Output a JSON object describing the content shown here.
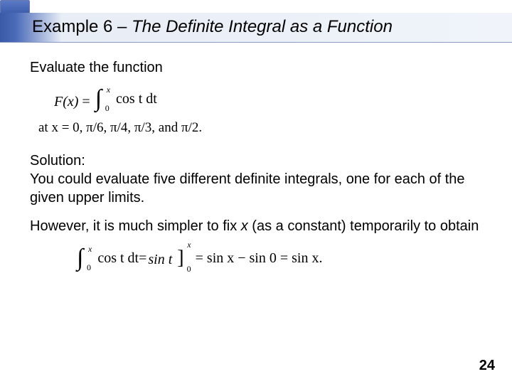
{
  "title": {
    "example": "Example 6",
    "dash": " – ",
    "subject": "The Definite Integral as a Function"
  },
  "content": {
    "prompt": "Evaluate the function",
    "formula1": {
      "lhs": "F(x)",
      "eq": " = ",
      "int_lower": "0",
      "int_upper": "x",
      "integrand": " cos t dt"
    },
    "at_line": "at x = 0, π/6, π/4, π/3, and π/2.",
    "solution_label": "Solution:",
    "para1": "You could evaluate five different definite integrals, one for each of the given upper limits.",
    "para2a": "However, it is much simpler to fix ",
    "para2_x": "x",
    "para2b": " (as a constant) temporarily to obtain",
    "formula2": {
      "int_lower": "0",
      "int_upper": "x",
      "integrand": "cos t dt",
      "eq1": " = ",
      "bracket_content": "sin t",
      "bracket_lower": "0",
      "bracket_upper": "x",
      "eq2": " = sin x − sin 0 = sin x."
    }
  },
  "page_number": "24"
}
